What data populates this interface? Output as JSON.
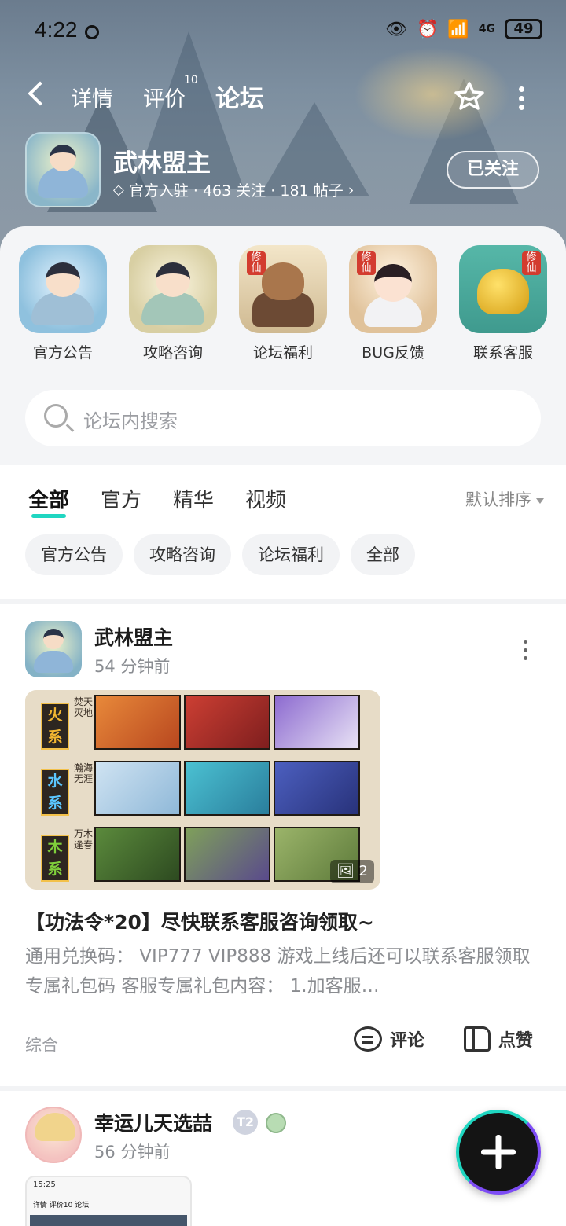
{
  "status_bar": {
    "time": "4:22",
    "battery": "49",
    "network": "4G"
  },
  "nav": {
    "tabs": [
      {
        "label": "详情"
      },
      {
        "label": "评价",
        "badge": "10"
      },
      {
        "label": "论坛"
      }
    ],
    "active_tab": "论坛",
    "accent": "#1fd6c1"
  },
  "game": {
    "name": "武林盟主",
    "meta": "官方入驻 · 463 关注 · 181 帖子",
    "follow_label": "已关注"
  },
  "categories": [
    {
      "label": "官方公告"
    },
    {
      "label": "攻略咨询"
    },
    {
      "label": "论坛福利"
    },
    {
      "label": "BUG反馈"
    },
    {
      "label": "联系客服"
    }
  ],
  "search": {
    "placeholder": "论坛内搜索"
  },
  "filter_tabs": [
    "全部",
    "官方",
    "精华",
    "视频"
  ],
  "sort_label": "默认排序",
  "chips": [
    "官方公告",
    "攻略咨询",
    "论坛福利",
    "全部"
  ],
  "post1": {
    "author": "武林盟主",
    "time": "54 分钟前",
    "image_count": "2",
    "image_rows": [
      {
        "element": "火系",
        "subtitle": "焚天灭地"
      },
      {
        "element": "水系",
        "subtitle": "瀚海无涯"
      },
      {
        "element": "木系",
        "subtitle": "万木逢春"
      }
    ],
    "title": "【功法令*20】尽快联系客服咨询领取~",
    "body": "通用兑换码： VIP777 VIP888 游戏上线后还可以联系客服领取专属礼包码 客服专属礼包内容： 1.加客服…",
    "tag": "综合",
    "comment_label": "评论",
    "like_label": "点赞"
  },
  "post2": {
    "author": "幸运儿天选喆",
    "level_badge": "T2",
    "time": "56 分钟前",
    "thumb_time": "15:25",
    "thumb_nav": "详情 评价10 论坛"
  }
}
